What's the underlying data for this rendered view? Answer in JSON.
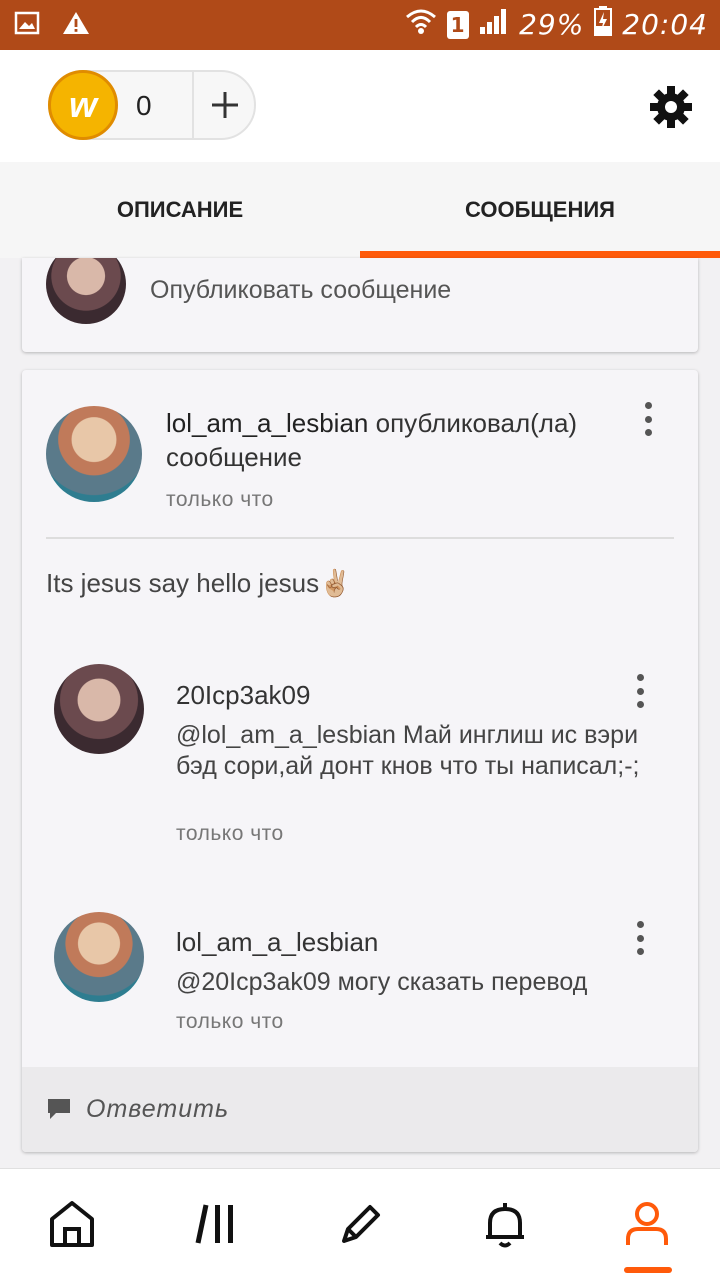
{
  "status_bar": {
    "sim": "1",
    "battery": "29%",
    "time": "20:04",
    "icons": [
      "image-icon",
      "warning-icon",
      "wifi-icon",
      "signal-icon",
      "battery-charging-icon"
    ]
  },
  "header": {
    "coin_icon_letter": "w",
    "coin_count": "0",
    "add_icon": "plus-icon",
    "settings_icon": "gear-icon"
  },
  "tabs": [
    {
      "label": "ОПИСАНИЕ",
      "active": false
    },
    {
      "label": "СООБЩЕНИЯ",
      "active": true
    }
  ],
  "compose": {
    "placeholder": "Опубликовать сообщение"
  },
  "message": {
    "author": "lol_am_a_lesbian",
    "action": "опубликовал(ла) сообщение",
    "time": "только что",
    "body": "Its jesus  say hello jesus✌🏼",
    "replies": [
      {
        "author": "20Icp3ak09",
        "text": "@lol_am_a_lesbian  Май инглиш ис вэри бэд сори,ай донт кнов что ты написал;-;",
        "time": "только что"
      },
      {
        "author": "lol_am_a_lesbian",
        "text": "@20Icp3ak09  могу сказать перевод",
        "time": "только что"
      }
    ],
    "reply_label": "Ответить"
  },
  "bottom_nav": [
    "home-icon",
    "library-icon",
    "write-icon",
    "bell-icon",
    "profile-icon"
  ],
  "colors": {
    "status_bar": "#b04a18",
    "accent": "#ff5a0a",
    "coin": "#f5b400"
  }
}
